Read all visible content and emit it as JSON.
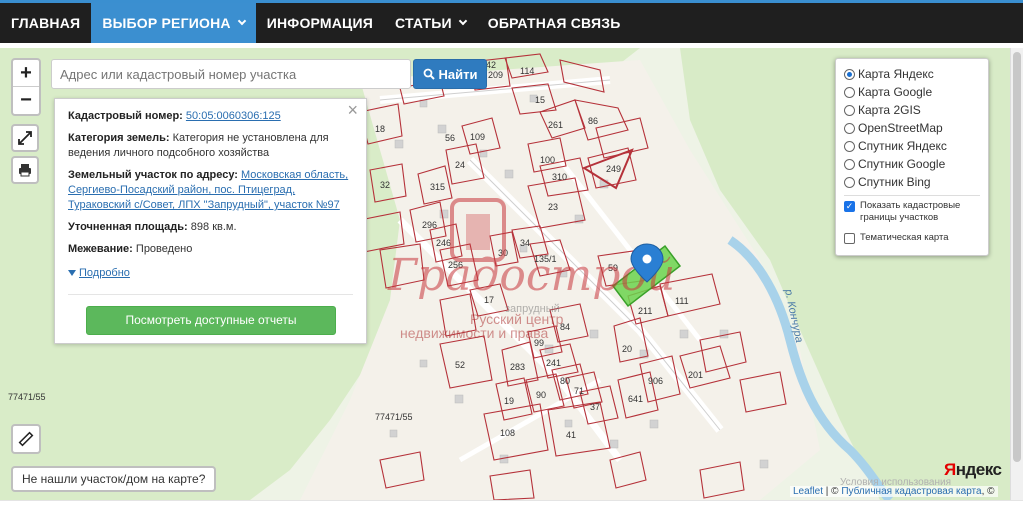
{
  "nav": {
    "items": [
      {
        "label": "ГЛАВНАЯ"
      },
      {
        "label": "ВЫБОР РЕГИОНА"
      },
      {
        "label": "ИНФОРМАЦИЯ"
      },
      {
        "label": "СТАТЬИ"
      },
      {
        "label": "ОБРАТНАЯ СВЯЗЬ"
      }
    ]
  },
  "search": {
    "placeholder": "Адрес или кадастровый номер участка",
    "button_label": "Найти"
  },
  "zoom": {
    "in_label": "+",
    "out_label": "−"
  },
  "card": {
    "cadastral_label": "Кадастровый номер:",
    "cadastral_value": "50:05:0060306:125",
    "category_label": "Категория земель:",
    "category_value": "Категория не установлена для ведения личного подсобного хозяйства",
    "address_label": "Земельный участок по адресу:",
    "address_value": "Московская область, Сергиево-Посадский район, пос. Птицеград, Тураковский с/Совет, ЛПХ \"Запрудный\", участок №97",
    "area_label": "Уточненная площадь:",
    "area_value": "898 кв.м.",
    "survey_label": "Межевание:",
    "survey_value": "Проведено",
    "more_label": "Подробно",
    "close_label": "×",
    "report_button": "Посмотреть доступные отчеты"
  },
  "layers": {
    "options": [
      {
        "label": "Карта Яндекс",
        "selected": true
      },
      {
        "label": "Карта Google",
        "selected": false
      },
      {
        "label": "Карта 2GIS",
        "selected": false
      },
      {
        "label": "OpenStreetMap",
        "selected": false
      },
      {
        "label": "Спутник Яндекс",
        "selected": false
      },
      {
        "label": "Спутник Google",
        "selected": false
      },
      {
        "label": "Спутник Bing",
        "selected": false
      }
    ],
    "checks": [
      {
        "label": "Показать кадастровые границы участков",
        "checked": true
      },
      {
        "label": "Тематическая карта",
        "checked": false
      }
    ]
  },
  "map": {
    "river_label": "р. Кончура",
    "parcel_labels": [
      "114",
      "209",
      "42",
      "15",
      "261",
      "86",
      "18",
      "56",
      "109",
      "32",
      "100",
      "310",
      "249",
      "315",
      "24",
      "23",
      "296",
      "246",
      "30",
      "34",
      "135/1",
      "59",
      "256",
      "17",
      "211",
      "111",
      "84",
      "52",
      "283",
      "99",
      "241",
      "80",
      "20",
      "201",
      "906",
      "641",
      "19",
      "90",
      "71",
      "37",
      "108",
      "41",
      "77471/55",
      "77471/55"
    ],
    "watermark_line1": "Русский центр",
    "watermark_line2": "недвижимости и права",
    "watermark_brand": "Градострой",
    "watermark_sub": "запрудный"
  },
  "not_found_label": "Не нашли участок/дом на карте?",
  "attribution": {
    "leaflet": "Leaflet",
    "sep": " | © ",
    "source": "Публичная кадастровая карта",
    "tail": ", ©"
  },
  "yandex": {
    "first": "Я",
    "rest": "ндекс"
  },
  "terms_text": "Условия использования"
}
